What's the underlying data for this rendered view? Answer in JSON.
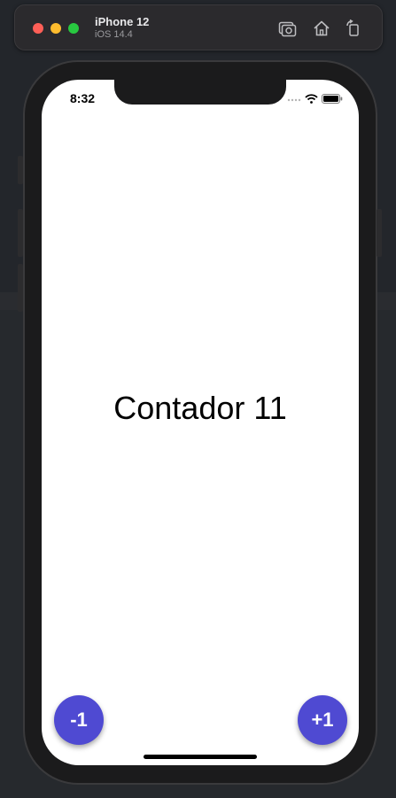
{
  "simulator": {
    "device_name": "iPhone 12",
    "os_version": "iOS 14.4",
    "icons": [
      "screenshot-icon",
      "home-icon",
      "rotate-icon"
    ]
  },
  "status_bar": {
    "time": "8:32",
    "icons": [
      "cellular-dots-icon",
      "wifi-icon",
      "battery-icon"
    ]
  },
  "app": {
    "counter_text": "Contador 11",
    "decrement_label": "-1",
    "increment_label": "+1",
    "accent_color": "#4f4ad2"
  }
}
